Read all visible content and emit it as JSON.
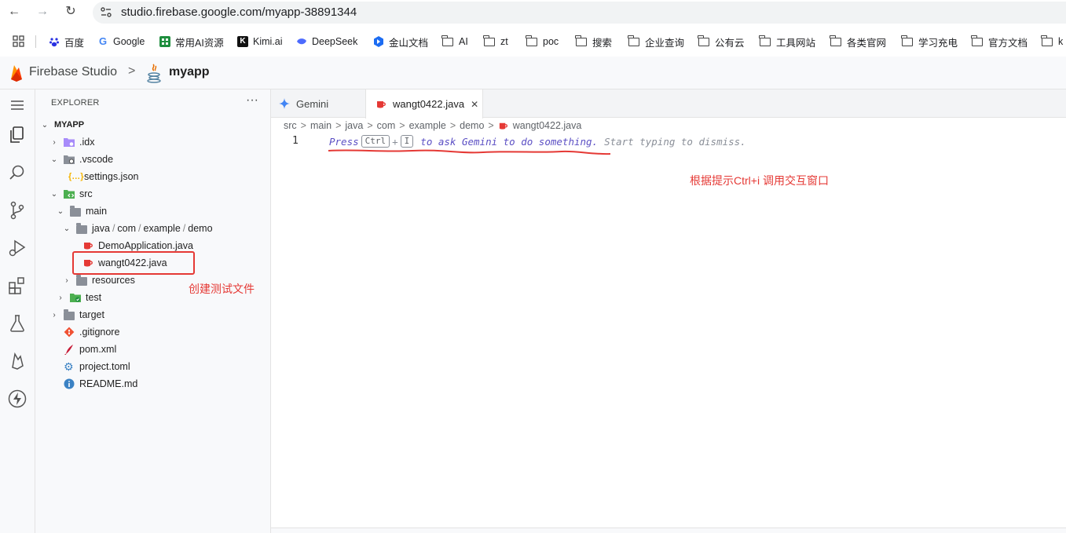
{
  "browser": {
    "url": "studio.firebase.google.com/myapp-38891344",
    "bookmarks": [
      "百度",
      "Google",
      "常用AI资源",
      "Kimi.ai",
      "DeepSeek",
      "金山文档",
      "AI",
      "zt",
      "poc",
      "搜索",
      "企业查询",
      "公有云",
      "工具网站",
      "各类官网",
      "学习充电",
      "官方文档",
      "k"
    ]
  },
  "studio": {
    "brand": "Firebase Studio",
    "separator": ">",
    "project": "myapp"
  },
  "explorer": {
    "title": "EXPLORER",
    "more": "···",
    "root": "MYAPP",
    "items": [
      ".idx",
      ".vscode",
      "settings.json",
      "src",
      "main",
      "java",
      "com",
      "example",
      "demo",
      "DemoApplication.java",
      "wangt0422.java",
      "resources",
      "test",
      "target",
      ".gitignore",
      "pom.xml",
      "project.toml",
      "README.md"
    ],
    "path_sep": "/"
  },
  "tabs": [
    {
      "label": "Gemini"
    },
    {
      "label": "wangt0422.java",
      "close": "✕"
    }
  ],
  "breadcrumb": [
    "src",
    "main",
    "java",
    "com",
    "example",
    "demo",
    "wangt0422.java"
  ],
  "breadcrumb_sep": ">",
  "editor": {
    "line_number": "1",
    "hint_press": "Press",
    "key_ctrl": "Ctrl",
    "plus": "+",
    "key_i": "I",
    "hint_rest": "to ask Gemini to do something.",
    "hint_dismiss": "Start typing to dismiss."
  },
  "annotations": {
    "create_file": "创建测试文件",
    "ctrl_i_hint": "根据提示Ctrl+i 调用交互窗口"
  },
  "colors": {
    "annotation": "#e53935",
    "java_icon": "#e53935",
    "gemini": "#4285f4",
    "hint_accent": "#5b4fc4"
  }
}
